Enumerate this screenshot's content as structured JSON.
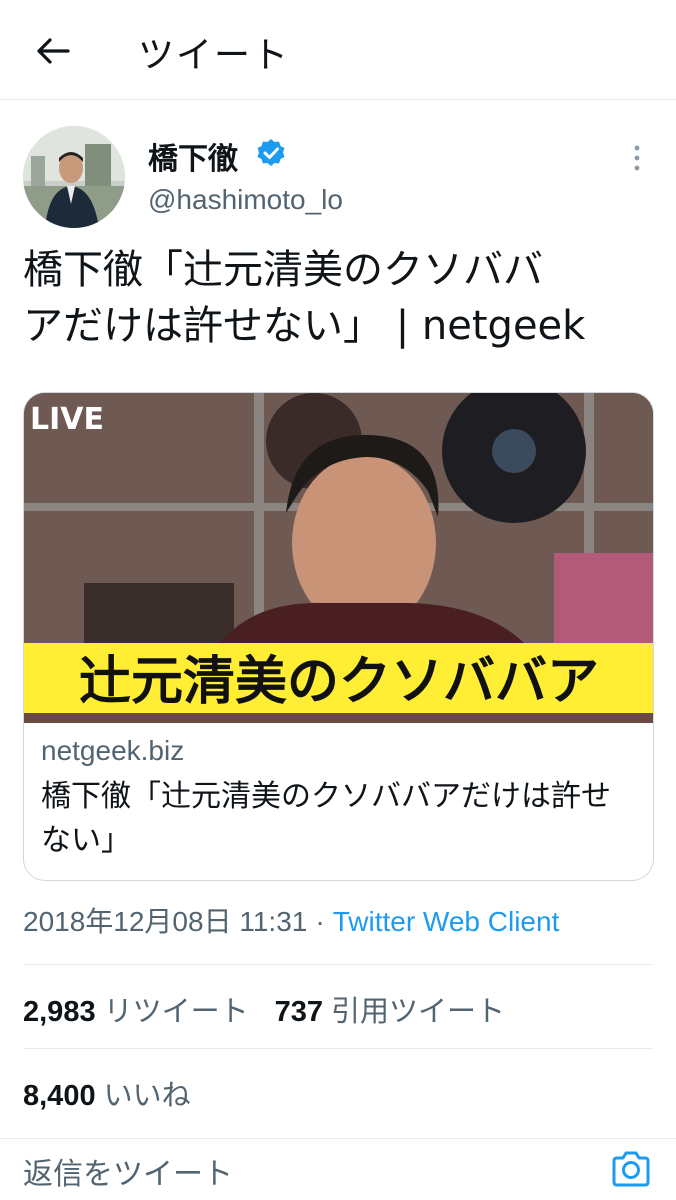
{
  "header": {
    "title": "ツイート"
  },
  "author": {
    "name": "橋下徹",
    "handle": "@hashimoto_lo"
  },
  "tweet": {
    "text_line1": "橋下徹「辻元清美のクソババ",
    "text_line2": "アだけは許せない」 | netgeek"
  },
  "card": {
    "image_badge": "LIVE",
    "image_caption": "辻元清美のクソババア",
    "domain": "netgeek.biz",
    "title": "橋下徹「辻元清美のクソババアだけは許せない」"
  },
  "meta": {
    "timestamp": "2018年12月08日 11:31",
    "separator": "·",
    "client": "Twitter Web Client"
  },
  "stats": {
    "retweets": "2,983",
    "retweets_label": "リツイート",
    "quotes": "737",
    "quotes_label": "引用ツイート",
    "likes": "8,400",
    "likes_label": "いいね"
  },
  "reply": {
    "placeholder": "返信をツイート"
  },
  "colors": {
    "accent": "#1d9bf0",
    "secondary_text": "#536471",
    "caption_bg": "#ffee33"
  },
  "icons": [
    "back-arrow-icon",
    "verified-badge-icon",
    "more-vertical-icon",
    "camera-icon"
  ]
}
